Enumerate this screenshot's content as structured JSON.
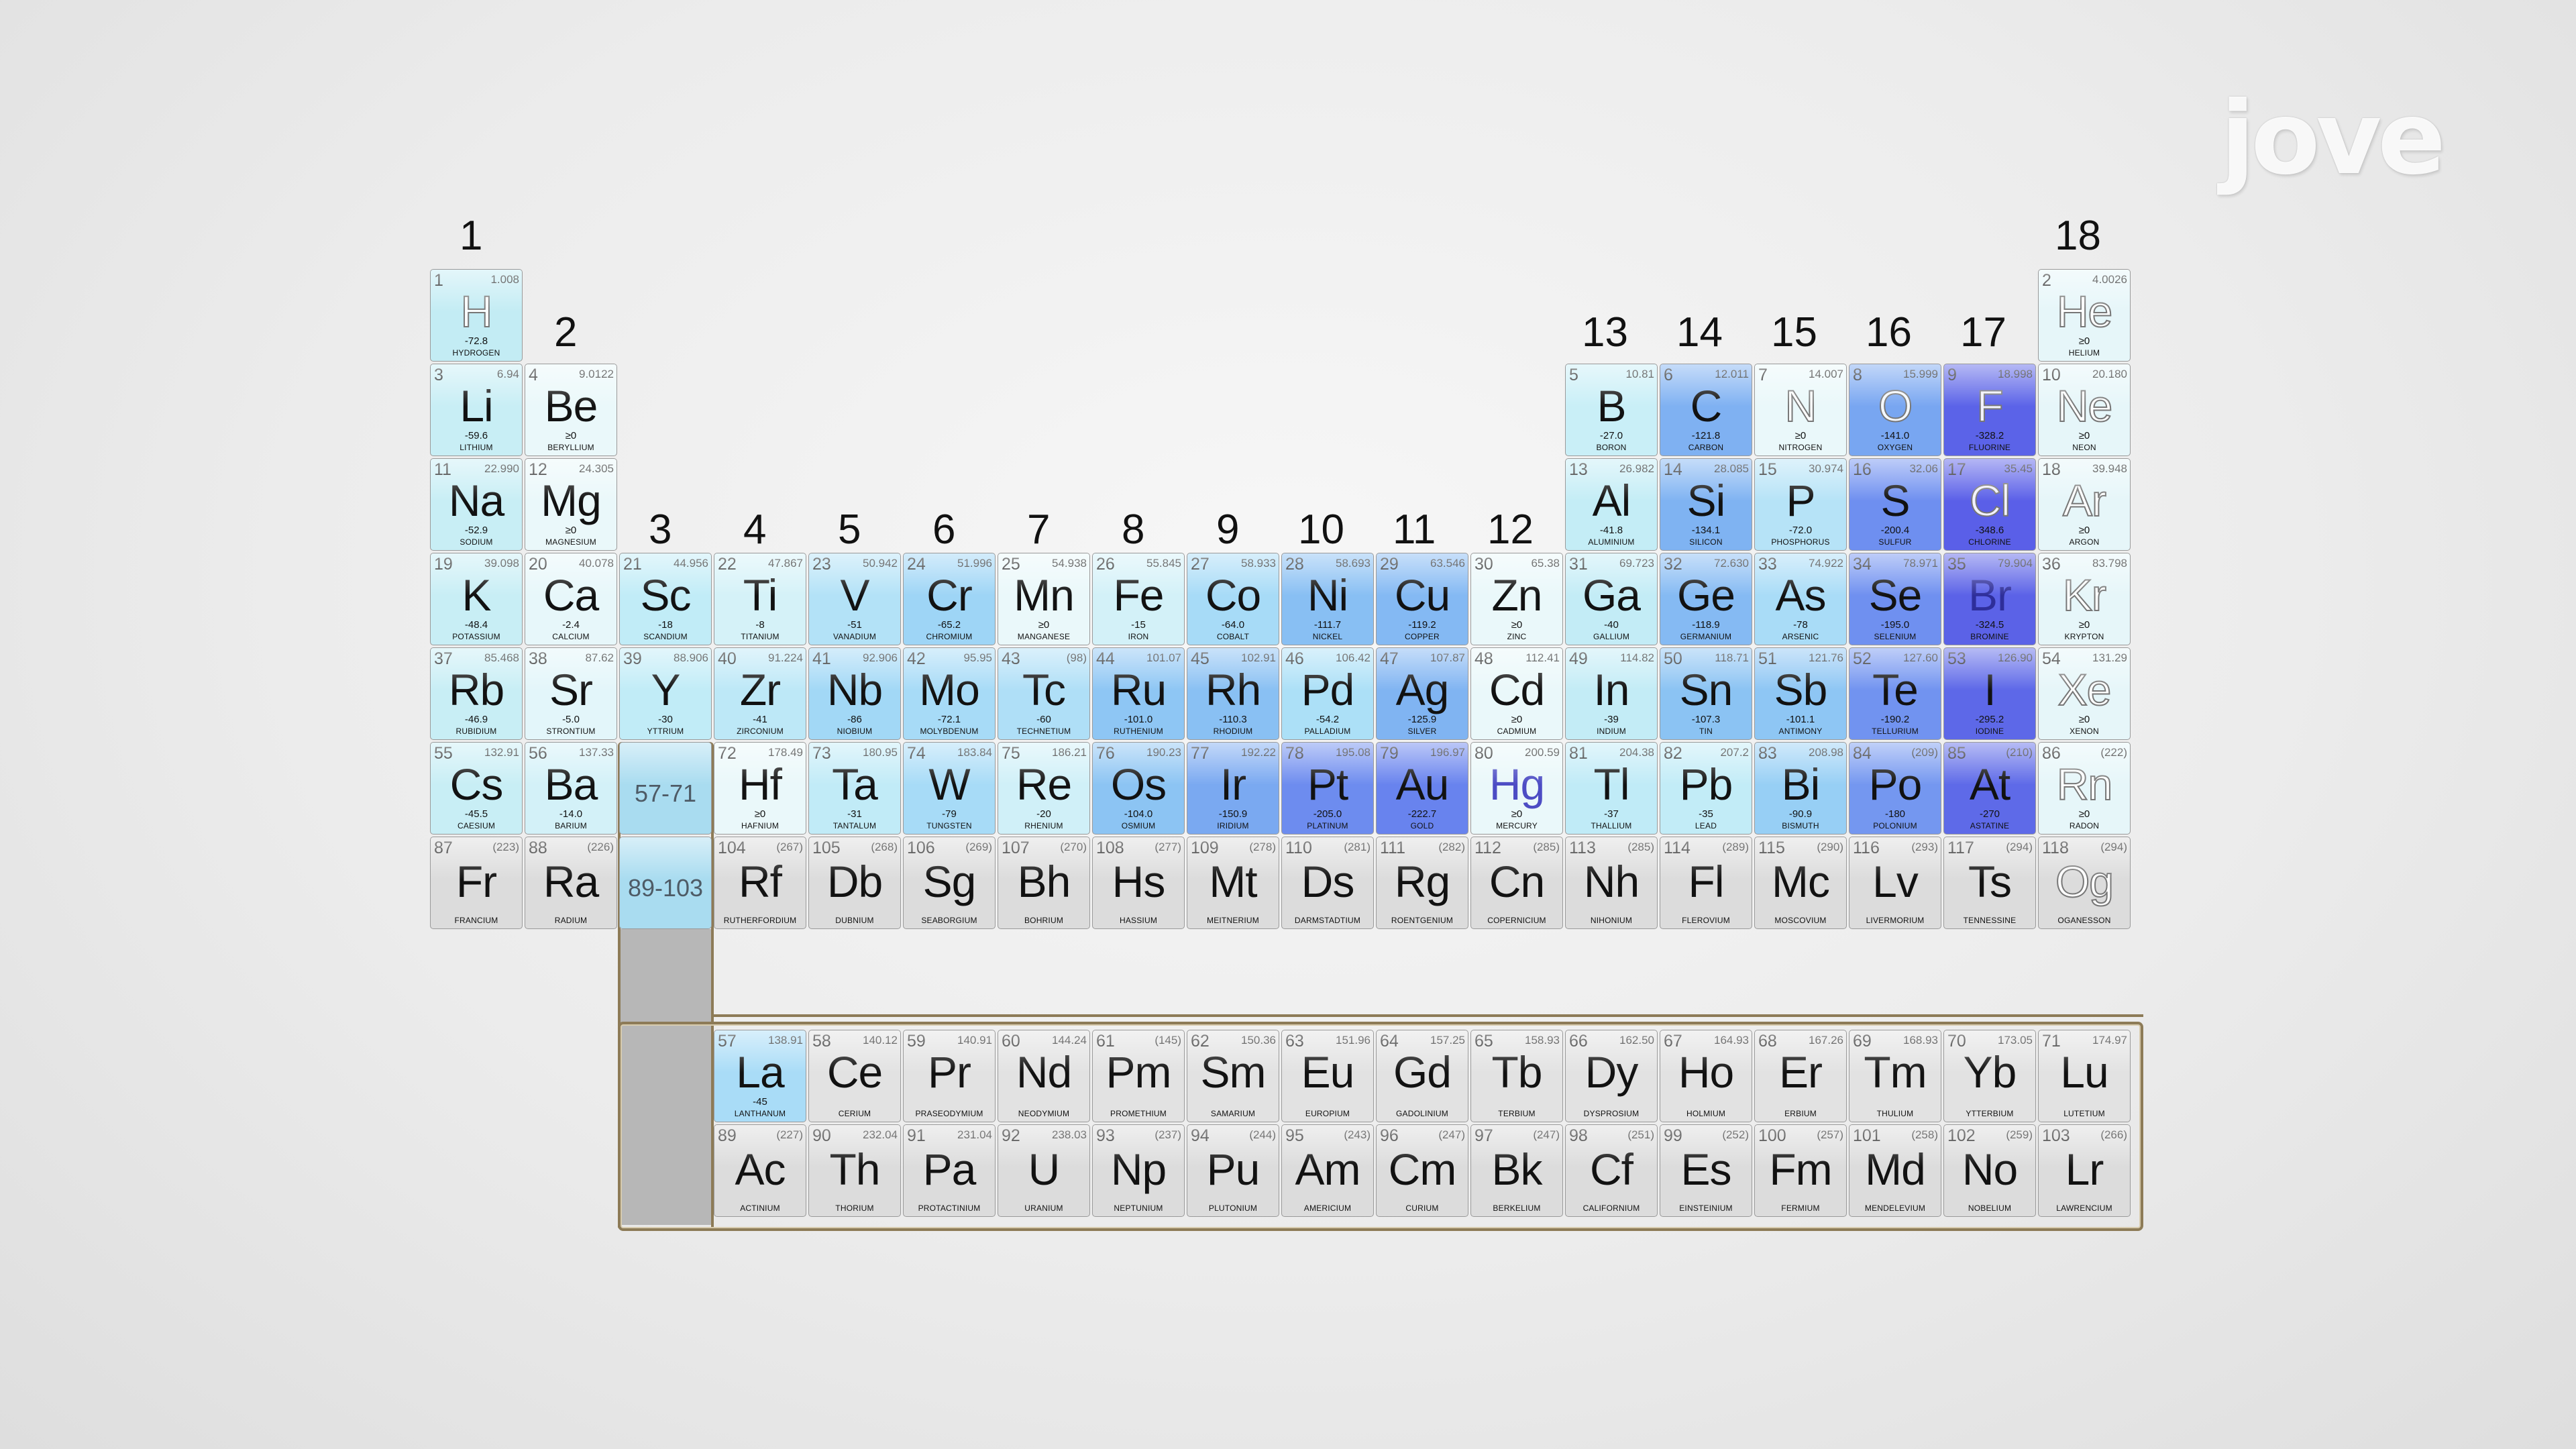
{
  "group_labels": [
    "1",
    "2",
    "3",
    "4",
    "5",
    "6",
    "7",
    "8",
    "9",
    "10",
    "11",
    "12",
    "13",
    "14",
    "15",
    "16",
    "17",
    "18"
  ],
  "logo_text": "jove",
  "elements": [
    {
      "n": "1",
      "s": "H",
      "m": "1.008",
      "ea": "-72.8",
      "nm": "HYDROGEN",
      "x": 0,
      "y": 0,
      "c": "#c3ecf4",
      "t": "outline"
    },
    {
      "n": "2",
      "s": "He",
      "m": "4.0026",
      "ea": "≥0",
      "nm": "HELIUM",
      "x": 17,
      "y": 0,
      "c": "#e6f6f9",
      "t": "outline"
    },
    {
      "n": "3",
      "s": "Li",
      "m": "6.94",
      "ea": "-59.6",
      "nm": "LITHIUM",
      "x": 0,
      "y": 1,
      "c": "#c8eef5"
    },
    {
      "n": "4",
      "s": "Be",
      "m": "9.0122",
      "ea": "≥0",
      "nm": "BERYLLIUM",
      "x": 1,
      "y": 1,
      "c": "#eaf8fa"
    },
    {
      "n": "5",
      "s": "B",
      "m": "10.81",
      "ea": "-27.0",
      "nm": "BORON",
      "x": 12,
      "y": 1,
      "c": "#c9eff7"
    },
    {
      "n": "6",
      "s": "C",
      "m": "12.011",
      "ea": "-121.8",
      "nm": "CARBON",
      "x": 13,
      "y": 1,
      "c": "#7fb1f2"
    },
    {
      "n": "7",
      "s": "N",
      "m": "14.007",
      "ea": "≥0",
      "nm": "NITROGEN",
      "x": 14,
      "y": 1,
      "c": "#eaf8fa",
      "t": "outline"
    },
    {
      "n": "8",
      "s": "O",
      "m": "15.999",
      "ea": "-141.0",
      "nm": "OXYGEN",
      "x": 15,
      "y": 1,
      "c": "#78a6f1",
      "t": "outline"
    },
    {
      "n": "9",
      "s": "F",
      "m": "18.998",
      "ea": "-328.2",
      "nm": "FLUORINE",
      "x": 16,
      "y": 1,
      "c": "#5b63e8",
      "t": "outline"
    },
    {
      "n": "10",
      "s": "Ne",
      "m": "20.180",
      "ea": "≥0",
      "nm": "NEON",
      "x": 17,
      "y": 1,
      "c": "#e6f6f9",
      "t": "outline"
    },
    {
      "n": "11",
      "s": "Na",
      "m": "22.990",
      "ea": "-52.9",
      "nm": "SODIUM",
      "x": 0,
      "y": 2,
      "c": "#c8eef5"
    },
    {
      "n": "12",
      "s": "Mg",
      "m": "24.305",
      "ea": "≥0",
      "nm": "MAGNESIUM",
      "x": 1,
      "y": 2,
      "c": "#eaf8fa"
    },
    {
      "n": "13",
      "s": "Al",
      "m": "26.982",
      "ea": "-41.8",
      "nm": "ALUMINIUM",
      "x": 12,
      "y": 2,
      "c": "#c4edf6"
    },
    {
      "n": "14",
      "s": "Si",
      "m": "28.085",
      "ea": "-134.1",
      "nm": "SILICON",
      "x": 13,
      "y": 2,
      "c": "#7fb3f2"
    },
    {
      "n": "15",
      "s": "P",
      "m": "30.974",
      "ea": "-72.0",
      "nm": "PHOSPHORUS",
      "x": 14,
      "y": 2,
      "c": "#b6e3f7"
    },
    {
      "n": "16",
      "s": "S",
      "m": "32.06",
      "ea": "-200.4",
      "nm": "SULFUR",
      "x": 15,
      "y": 2,
      "c": "#6e8ff0"
    },
    {
      "n": "17",
      "s": "Cl",
      "m": "35.45",
      "ea": "-348.6",
      "nm": "CHLORINE",
      "x": 16,
      "y": 2,
      "c": "#5a5fe8",
      "t": "outline"
    },
    {
      "n": "18",
      "s": "Ar",
      "m": "39.948",
      "ea": "≥0",
      "nm": "ARGON",
      "x": 17,
      "y": 2,
      "c": "#e6f6f9",
      "t": "outline"
    },
    {
      "n": "19",
      "s": "K",
      "m": "39.098",
      "ea": "-48.4",
      "nm": "POTASSIUM",
      "x": 0,
      "y": 3,
      "c": "#c8eef5"
    },
    {
      "n": "20",
      "s": "Ca",
      "m": "40.078",
      "ea": "-2.4",
      "nm": "CALCIUM",
      "x": 1,
      "y": 3,
      "c": "#e7f7fa"
    },
    {
      "n": "21",
      "s": "Sc",
      "m": "44.956",
      "ea": "-18",
      "nm": "SCANDIUM",
      "x": 2,
      "y": 3,
      "c": "#c1ecf7"
    },
    {
      "n": "22",
      "s": "Ti",
      "m": "47.867",
      "ea": "-8",
      "nm": "TITANIUM",
      "x": 3,
      "y": 3,
      "c": "#d5f2f8"
    },
    {
      "n": "23",
      "s": "V",
      "m": "50.942",
      "ea": "-51",
      "nm": "VANADIUM",
      "x": 4,
      "y": 3,
      "c": "#b3e2f7"
    },
    {
      "n": "24",
      "s": "Cr",
      "m": "51.996",
      "ea": "-65.2",
      "nm": "CHROMIUM",
      "x": 5,
      "y": 3,
      "c": "#9ed5f6"
    },
    {
      "n": "25",
      "s": "Mn",
      "m": "54.938",
      "ea": "≥0",
      "nm": "MANGANESE",
      "x": 6,
      "y": 3,
      "c": "#eaf8fa"
    },
    {
      "n": "26",
      "s": "Fe",
      "m": "55.845",
      "ea": "-15",
      "nm": "IRON",
      "x": 7,
      "y": 3,
      "c": "#d3f1f8"
    },
    {
      "n": "27",
      "s": "Co",
      "m": "58.933",
      "ea": "-64.0",
      "nm": "COBALT",
      "x": 8,
      "y": 3,
      "c": "#a7dbf7"
    },
    {
      "n": "28",
      "s": "Ni",
      "m": "58.693",
      "ea": "-111.7",
      "nm": "NICKEL",
      "x": 9,
      "y": 3,
      "c": "#88bff3"
    },
    {
      "n": "29",
      "s": "Cu",
      "m": "63.546",
      "ea": "-119.2",
      "nm": "COPPER",
      "x": 10,
      "y": 3,
      "c": "#84b9f3"
    },
    {
      "n": "30",
      "s": "Zn",
      "m": "65.38",
      "ea": "≥0",
      "nm": "ZINC",
      "x": 11,
      "y": 3,
      "c": "#eaf8fa"
    },
    {
      "n": "31",
      "s": "Ga",
      "m": "69.723",
      "ea": "-40",
      "nm": "GALLIUM",
      "x": 12,
      "y": 3,
      "c": "#c3ecf6"
    },
    {
      "n": "32",
      "s": "Ge",
      "m": "72.630",
      "ea": "-118.9",
      "nm": "GERMANIUM",
      "x": 13,
      "y": 3,
      "c": "#85baf3"
    },
    {
      "n": "33",
      "s": "As",
      "m": "74.922",
      "ea": "-78",
      "nm": "ARSENIC",
      "x": 14,
      "y": 3,
      "c": "#a9dcf7"
    },
    {
      "n": "34",
      "s": "Se",
      "m": "78.971",
      "ea": "-195.0",
      "nm": "SELENIUM",
      "x": 15,
      "y": 3,
      "c": "#6f90f0"
    },
    {
      "n": "35",
      "s": "Br",
      "m": "79.904",
      "ea": "-324.5",
      "nm": "BROMINE",
      "x": 16,
      "y": 3,
      "c": "#5b62e7",
      "t": "darkpurple"
    },
    {
      "n": "36",
      "s": "Kr",
      "m": "83.798",
      "ea": "≥0",
      "nm": "KRYPTON",
      "x": 17,
      "y": 3,
      "c": "#e6f6f9",
      "t": "outline"
    },
    {
      "n": "37",
      "s": "Rb",
      "m": "85.468",
      "ea": "-46.9",
      "nm": "RUBIDIUM",
      "x": 0,
      "y": 4,
      "c": "#c8eef5"
    },
    {
      "n": "38",
      "s": "Sr",
      "m": "87.62",
      "ea": "-5.0",
      "nm": "STRONTIUM",
      "x": 1,
      "y": 4,
      "c": "#e3f6fa"
    },
    {
      "n": "39",
      "s": "Y",
      "m": "88.906",
      "ea": "-30",
      "nm": "YTTRIUM",
      "x": 2,
      "y": 4,
      "c": "#c1ecf7"
    },
    {
      "n": "40",
      "s": "Zr",
      "m": "91.224",
      "ea": "-41",
      "nm": "ZIRCONIUM",
      "x": 3,
      "y": 4,
      "c": "#bde8f7"
    },
    {
      "n": "41",
      "s": "Nb",
      "m": "92.906",
      "ea": "-86",
      "nm": "NIOBIUM",
      "x": 4,
      "y": 4,
      "c": "#a2d8f6"
    },
    {
      "n": "42",
      "s": "Mo",
      "m": "95.95",
      "ea": "-72.1",
      "nm": "MOLYBDENUM",
      "x": 5,
      "y": 4,
      "c": "#a7dbf7"
    },
    {
      "n": "43",
      "s": "Tc",
      "m": "(98)",
      "ea": "-60",
      "nm": "TECHNETIUM",
      "x": 6,
      "y": 4,
      "c": "#afdff7"
    },
    {
      "n": "44",
      "s": "Ru",
      "m": "101.07",
      "ea": "-101.0",
      "nm": "RUTHENIUM",
      "x": 7,
      "y": 4,
      "c": "#8ec6f4"
    },
    {
      "n": "45",
      "s": "Rh",
      "m": "102.91",
      "ea": "-110.3",
      "nm": "RHODIUM",
      "x": 8,
      "y": 4,
      "c": "#89c0f3"
    },
    {
      "n": "46",
      "s": "Pd",
      "m": "106.42",
      "ea": "-54.2",
      "nm": "PALLADIUM",
      "x": 9,
      "y": 4,
      "c": "#ace0f7"
    },
    {
      "n": "47",
      "s": "Ag",
      "m": "107.87",
      "ea": "-125.9",
      "nm": "SILVER",
      "x": 10,
      "y": 4,
      "c": "#80b4f2"
    },
    {
      "n": "48",
      "s": "Cd",
      "m": "112.41",
      "ea": "≥0",
      "nm": "CADMIUM",
      "x": 11,
      "y": 4,
      "c": "#eaf8fa"
    },
    {
      "n": "49",
      "s": "In",
      "m": "114.82",
      "ea": "-39",
      "nm": "INDIUM",
      "x": 12,
      "y": 4,
      "c": "#c3ecf6"
    },
    {
      "n": "50",
      "s": "Sn",
      "m": "118.71",
      "ea": "-107.3",
      "nm": "TIN",
      "x": 13,
      "y": 4,
      "c": "#8bc3f3"
    },
    {
      "n": "51",
      "s": "Sb",
      "m": "121.76",
      "ea": "-101.1",
      "nm": "ANTIMONY",
      "x": 14,
      "y": 4,
      "c": "#8ec6f4"
    },
    {
      "n": "52",
      "s": "Te",
      "m": "127.60",
      "ea": "-190.2",
      "nm": "TELLURIUM",
      "x": 15,
      "y": 4,
      "c": "#7193f0"
    },
    {
      "n": "53",
      "s": "I",
      "m": "126.90",
      "ea": "-295.2",
      "nm": "IODINE",
      "x": 16,
      "y": 4,
      "c": "#5d68e8"
    },
    {
      "n": "54",
      "s": "Xe",
      "m": "131.29",
      "ea": "≥0",
      "nm": "XENON",
      "x": 17,
      "y": 4,
      "c": "#e6f6f9",
      "t": "outline"
    },
    {
      "n": "55",
      "s": "Cs",
      "m": "132.91",
      "ea": "-45.5",
      "nm": "CAESIUM",
      "x": 0,
      "y": 5,
      "c": "#c8eef5"
    },
    {
      "n": "56",
      "s": "Ba",
      "m": "137.33",
      "ea": "-14.0",
      "nm": "BARIUM",
      "x": 1,
      "y": 5,
      "c": "#d3f1f8"
    },
    {
      "n": "72",
      "s": "Hf",
      "m": "178.49",
      "ea": "≥0",
      "nm": "HAFNIUM",
      "x": 3,
      "y": 5,
      "c": "#eaf8fa"
    },
    {
      "n": "73",
      "s": "Ta",
      "m": "180.95",
      "ea": "-31",
      "nm": "TANTALUM",
      "x": 4,
      "y": 5,
      "c": "#c1ebf7"
    },
    {
      "n": "74",
      "s": "W",
      "m": "183.84",
      "ea": "-79",
      "nm": "TUNGSTEN",
      "x": 5,
      "y": 5,
      "c": "#a7dbf7"
    },
    {
      "n": "75",
      "s": "Re",
      "m": "186.21",
      "ea": "-20",
      "nm": "RHENIUM",
      "x": 6,
      "y": 5,
      "c": "#d0f0f8"
    },
    {
      "n": "76",
      "s": "Os",
      "m": "190.23",
      "ea": "-104.0",
      "nm": "OSMIUM",
      "x": 7,
      "y": 5,
      "c": "#8cc4f3"
    },
    {
      "n": "77",
      "s": "Ir",
      "m": "192.22",
      "ea": "-150.9",
      "nm": "IRIDIUM",
      "x": 8,
      "y": 5,
      "c": "#7aa9f1"
    },
    {
      "n": "78",
      "s": "Pt",
      "m": "195.08",
      "ea": "-205.0",
      "nm": "PLATINUM",
      "x": 9,
      "y": 5,
      "c": "#6d8cef"
    },
    {
      "n": "79",
      "s": "Au",
      "m": "196.97",
      "ea": "-222.7",
      "nm": "GOLD",
      "x": 10,
      "y": 5,
      "c": "#6883ee"
    },
    {
      "n": "80",
      "s": "Hg",
      "m": "200.59",
      "ea": "≥0",
      "nm": "MERCURY",
      "x": 11,
      "y": 5,
      "c": "#eaf8fa",
      "t": "purple"
    },
    {
      "n": "81",
      "s": "Tl",
      "m": "204.38",
      "ea": "-37",
      "nm": "THALLIUM",
      "x": 12,
      "y": 5,
      "c": "#c0ebf7"
    },
    {
      "n": "82",
      "s": "Pb",
      "m": "207.2",
      "ea": "-35",
      "nm": "LEAD",
      "x": 13,
      "y": 5,
      "c": "#c2ecf7"
    },
    {
      "n": "83",
      "s": "Bi",
      "m": "208.98",
      "ea": "-90.9",
      "nm": "BISMUTH",
      "x": 14,
      "y": 5,
      "c": "#97cff5"
    },
    {
      "n": "84",
      "s": "Po",
      "m": "(209)",
      "ea": "-180",
      "nm": "POLONIUM",
      "x": 15,
      "y": 5,
      "c": "#7497f0"
    },
    {
      "n": "85",
      "s": "At",
      "m": "(210)",
      "ea": "-270",
      "nm": "ASTATINE",
      "x": 16,
      "y": 5,
      "c": "#5e6ae8"
    },
    {
      "n": "86",
      "s": "Rn",
      "m": "(222)",
      "ea": "≥0",
      "nm": "RADON",
      "x": 17,
      "y": 5,
      "c": "#e6f6f9",
      "t": "outline"
    },
    {
      "n": "87",
      "s": "Fr",
      "m": "(223)",
      "ea": "",
      "nm": "FRANCIUM",
      "x": 0,
      "y": 6,
      "c": "#dcdcdc",
      "t": "heavy"
    },
    {
      "n": "88",
      "s": "Ra",
      "m": "(226)",
      "ea": "",
      "nm": "RADIUM",
      "x": 1,
      "y": 6,
      "c": "#dcdcdc",
      "t": "heavy"
    },
    {
      "n": "104",
      "s": "Rf",
      "m": "(267)",
      "ea": "",
      "nm": "RUTHERFORDIUM",
      "x": 3,
      "y": 6,
      "c": "#dcdcdc",
      "t": "heavy"
    },
    {
      "n": "105",
      "s": "Db",
      "m": "(268)",
      "ea": "",
      "nm": "DUBNIUM",
      "x": 4,
      "y": 6,
      "c": "#dcdcdc",
      "t": "heavy"
    },
    {
      "n": "106",
      "s": "Sg",
      "m": "(269)",
      "ea": "",
      "nm": "SEABORGIUM",
      "x": 5,
      "y": 6,
      "c": "#dcdcdc",
      "t": "heavy"
    },
    {
      "n": "107",
      "s": "Bh",
      "m": "(270)",
      "ea": "",
      "nm": "BOHRIUM",
      "x": 6,
      "y": 6,
      "c": "#dcdcdc",
      "t": "heavy"
    },
    {
      "n": "108",
      "s": "Hs",
      "m": "(277)",
      "ea": "",
      "nm": "HASSIUM",
      "x": 7,
      "y": 6,
      "c": "#dcdcdc",
      "t": "heavy"
    },
    {
      "n": "109",
      "s": "Mt",
      "m": "(278)",
      "ea": "",
      "nm": "MEITNERIUM",
      "x": 8,
      "y": 6,
      "c": "#dcdcdc",
      "t": "heavy"
    },
    {
      "n": "110",
      "s": "Ds",
      "m": "(281)",
      "ea": "",
      "nm": "DARMSTADTIUM",
      "x": 9,
      "y": 6,
      "c": "#dcdcdc",
      "t": "heavy"
    },
    {
      "n": "111",
      "s": "Rg",
      "m": "(282)",
      "ea": "",
      "nm": "ROENTGENIUM",
      "x": 10,
      "y": 6,
      "c": "#dcdcdc",
      "t": "heavy"
    },
    {
      "n": "112",
      "s": "Cn",
      "m": "(285)",
      "ea": "",
      "nm": "COPERNICIUM",
      "x": 11,
      "y": 6,
      "c": "#dcdcdc",
      "t": "heavy"
    },
    {
      "n": "113",
      "s": "Nh",
      "m": "(285)",
      "ea": "",
      "nm": "NIHONIUM",
      "x": 12,
      "y": 6,
      "c": "#dcdcdc",
      "t": "heavy"
    },
    {
      "n": "114",
      "s": "Fl",
      "m": "(289)",
      "ea": "",
      "nm": "FLEROVIUM",
      "x": 13,
      "y": 6,
      "c": "#dcdcdc",
      "t": "heavy"
    },
    {
      "n": "115",
      "s": "Mc",
      "m": "(290)",
      "ea": "",
      "nm": "MOSCOVIUM",
      "x": 14,
      "y": 6,
      "c": "#dcdcdc",
      "t": "heavy"
    },
    {
      "n": "116",
      "s": "Lv",
      "m": "(293)",
      "ea": "",
      "nm": "LIVERMORIUM",
      "x": 15,
      "y": 6,
      "c": "#dcdcdc",
      "t": "heavy"
    },
    {
      "n": "117",
      "s": "Ts",
      "m": "(294)",
      "ea": "",
      "nm": "TENNESSINE",
      "x": 16,
      "y": 6,
      "c": "#dcdcdc",
      "t": "heavy"
    },
    {
      "n": "118",
      "s": "Og",
      "m": "(294)",
      "ea": "",
      "nm": "OGANESSON",
      "x": 17,
      "y": 6,
      "c": "#dcdcdc",
      "t": "heavy outline"
    }
  ],
  "placeholders": [
    {
      "s": "57-71",
      "x": 2,
      "y": 5,
      "c": "#a9dcf0"
    },
    {
      "s": "89-103",
      "x": 2,
      "y": 6,
      "c": "#a9dcf0"
    }
  ],
  "lanthanides": [
    {
      "n": "57",
      "s": "La",
      "m": "138.91",
      "ea": "-45",
      "nm": "LANTHANUM",
      "c": "#a9dcf7"
    },
    {
      "n": "58",
      "s": "Ce",
      "m": "140.12",
      "ea": "",
      "nm": "CERIUM",
      "c": "#e2e2e2"
    },
    {
      "n": "59",
      "s": "Pr",
      "m": "140.91",
      "ea": "",
      "nm": "PRASEODYMIUM",
      "c": "#e2e2e2"
    },
    {
      "n": "60",
      "s": "Nd",
      "m": "144.24",
      "ea": "",
      "nm": "NEODYMIUM",
      "c": "#e2e2e2"
    },
    {
      "n": "61",
      "s": "Pm",
      "m": "(145)",
      "ea": "",
      "nm": "PROMETHIUM",
      "c": "#e2e2e2"
    },
    {
      "n": "62",
      "s": "Sm",
      "m": "150.36",
      "ea": "",
      "nm": "SAMARIUM",
      "c": "#e2e2e2"
    },
    {
      "n": "63",
      "s": "Eu",
      "m": "151.96",
      "ea": "",
      "nm": "EUROPIUM",
      "c": "#e2e2e2"
    },
    {
      "n": "64",
      "s": "Gd",
      "m": "157.25",
      "ea": "",
      "nm": "GADOLINIUM",
      "c": "#e2e2e2"
    },
    {
      "n": "65",
      "s": "Tb",
      "m": "158.93",
      "ea": "",
      "nm": "TERBIUM",
      "c": "#e2e2e2"
    },
    {
      "n": "66",
      "s": "Dy",
      "m": "162.50",
      "ea": "",
      "nm": "DYSPROSIUM",
      "c": "#e2e2e2"
    },
    {
      "n": "67",
      "s": "Ho",
      "m": "164.93",
      "ea": "",
      "nm": "HOLMIUM",
      "c": "#e2e2e2"
    },
    {
      "n": "68",
      "s": "Er",
      "m": "167.26",
      "ea": "",
      "nm": "ERBIUM",
      "c": "#e2e2e2"
    },
    {
      "n": "69",
      "s": "Tm",
      "m": "168.93",
      "ea": "",
      "nm": "THULIUM",
      "c": "#e2e2e2"
    },
    {
      "n": "70",
      "s": "Yb",
      "m": "173.05",
      "ea": "",
      "nm": "YTTERBIUM",
      "c": "#e2e2e2"
    },
    {
      "n": "71",
      "s": "Lu",
      "m": "174.97",
      "ea": "",
      "nm": "LUTETIUM",
      "c": "#e2e2e2"
    }
  ],
  "actinides": [
    {
      "n": "89",
      "s": "Ac",
      "m": "(227)",
      "ea": "",
      "nm": "ACTINIUM",
      "c": "#dcdcdc"
    },
    {
      "n": "90",
      "s": "Th",
      "m": "232.04",
      "ea": "",
      "nm": "THORIUM",
      "c": "#dcdcdc"
    },
    {
      "n": "91",
      "s": "Pa",
      "m": "231.04",
      "ea": "",
      "nm": "PROTACTINIUM",
      "c": "#dcdcdc"
    },
    {
      "n": "92",
      "s": "U",
      "m": "238.03",
      "ea": "",
      "nm": "URANIUM",
      "c": "#dcdcdc"
    },
    {
      "n": "93",
      "s": "Np",
      "m": "(237)",
      "ea": "",
      "nm": "NEPTUNIUM",
      "c": "#dcdcdc"
    },
    {
      "n": "94",
      "s": "Pu",
      "m": "(244)",
      "ea": "",
      "nm": "PLUTONIUM",
      "c": "#dcdcdc"
    },
    {
      "n": "95",
      "s": "Am",
      "m": "(243)",
      "ea": "",
      "nm": "AMERICIUM",
      "c": "#dcdcdc"
    },
    {
      "n": "96",
      "s": "Cm",
      "m": "(247)",
      "ea": "",
      "nm": "CURIUM",
      "c": "#dcdcdc"
    },
    {
      "n": "97",
      "s": "Bk",
      "m": "(247)",
      "ea": "",
      "nm": "BERKELIUM",
      "c": "#dcdcdc"
    },
    {
      "n": "98",
      "s": "Cf",
      "m": "(251)",
      "ea": "",
      "nm": "CALIFORNIUM",
      "c": "#dcdcdc"
    },
    {
      "n": "99",
      "s": "Es",
      "m": "(252)",
      "ea": "",
      "nm": "EINSTEINIUM",
      "c": "#dcdcdc"
    },
    {
      "n": "100",
      "s": "Fm",
      "m": "(257)",
      "ea": "",
      "nm": "FERMIUM",
      "c": "#dcdcdc"
    },
    {
      "n": "101",
      "s": "Md",
      "m": "(258)",
      "ea": "",
      "nm": "MENDELEVIUM",
      "c": "#dcdcdc"
    },
    {
      "n": "102",
      "s": "No",
      "m": "(259)",
      "ea": "",
      "nm": "NOBELIUM",
      "c": "#dcdcdc"
    },
    {
      "n": "103",
      "s": "Lr",
      "m": "(266)",
      "ea": "",
      "nm": "LAWRENCIUM",
      "c": "#dcdcdc"
    }
  ]
}
